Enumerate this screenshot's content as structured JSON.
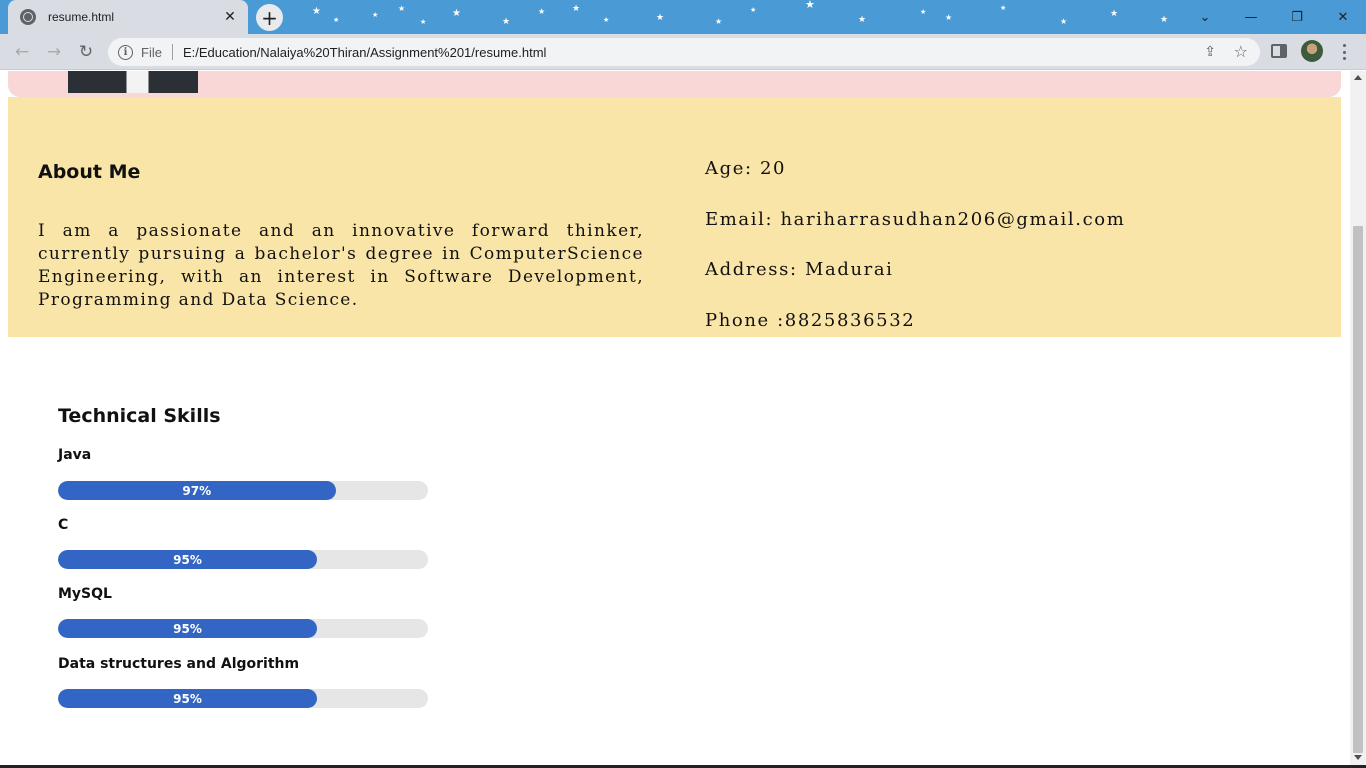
{
  "browser": {
    "tab_title": "resume.html",
    "tab_close_glyph": "✕",
    "new_tab_glyph": "+",
    "file_label": "File",
    "url": "E:/Education/Nalaiya%20Thiran/Assignment%201/resume.html",
    "window_controls": {
      "caret": "⌄",
      "minimize": "—",
      "maximize": "❐",
      "close": "✕"
    },
    "nav": {
      "back": "←",
      "forward": "→",
      "reload": "↻"
    },
    "icons": {
      "share": "⇪",
      "star": "☆"
    }
  },
  "colors": {
    "tabstrip": "#4a9ad6",
    "header_band": "#fad7d7",
    "about_band": "#fae5a8",
    "skill_fill": "#3366c4",
    "skill_track": "#e6e6e6"
  },
  "about": {
    "heading": "About Me",
    "text": "I am a passionate and an innovative forward thinker, currently pursuing a bachelor's degree in ComputerScience Engineering, with an interest in Software Development, Programming and Data Science."
  },
  "contact": {
    "age": "Age: 20",
    "email": "Email: hariharrasudhan206@gmail.com",
    "address": "Address: Madurai",
    "phone": "Phone :8825836532"
  },
  "skills": {
    "heading": "Technical Skills",
    "items": [
      {
        "name": "Java",
        "label": "97%",
        "level": 0.75
      },
      {
        "name": "C",
        "label": "95%",
        "level": 0.7
      },
      {
        "name": "MySQL",
        "label": "95%",
        "level": 0.7
      },
      {
        "name": "Data structures and Algorithm",
        "label": "95%",
        "level": 0.7
      }
    ]
  }
}
